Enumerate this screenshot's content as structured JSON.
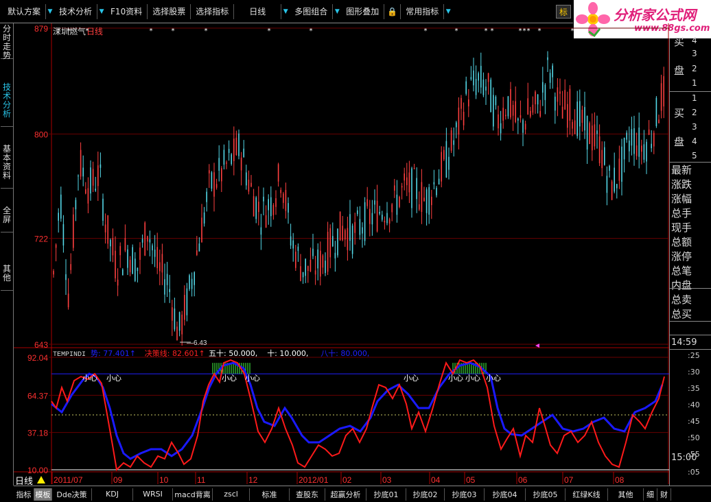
{
  "toolbar": {
    "items": [
      {
        "label": "默认方案",
        "arrow": true
      },
      {
        "label": "技术分析",
        "arrow": true
      },
      {
        "label": "F10资料",
        "arrow": false
      },
      {
        "label": "选择股票",
        "arrow": false
      },
      {
        "label": "选择指标",
        "arrow": false
      },
      {
        "label": "日线",
        "arrow": true
      },
      {
        "label": "多图组合",
        "arrow": true
      },
      {
        "label": "图形叠加",
        "arrow": false
      },
      {
        "label": "常用指标",
        "arrow": true
      }
    ],
    "flag_label": "标"
  },
  "brand": {
    "name": "分析家公式网",
    "url": "www.88gs.com"
  },
  "left_tabs": [
    "分时走势",
    "技术分析",
    "基本资料",
    "全屏",
    "其他"
  ],
  "chart": {
    "stock_label": "深圳燃气",
    "period_label": "日线",
    "price_axis": [
      "879",
      "800",
      "722",
      "643"
    ],
    "low_marker": "6.43",
    "indicator_name": "TEMPINDI",
    "indicator_legend": [
      {
        "label": "势: 77.401",
        "arrow": "↑",
        "color": "#2020ff"
      },
      {
        "label": "决策线: 82.601",
        "arrow": "↑",
        "color": "#ff2020"
      },
      {
        "label": "五十: 50.000,",
        "color": "#ffffff"
      },
      {
        "label": "十: 10.000,",
        "color": "#ffffff"
      },
      {
        "label": "八十: 80.000,",
        "color": "#2020ff"
      }
    ],
    "indicator_axis": [
      "92.04",
      "64.37",
      "37.18",
      "10.00"
    ],
    "signal_text": "小心",
    "date_labels": [
      "2011/07",
      "09",
      "10",
      "11",
      "12",
      "2012/01",
      "02",
      "03",
      "04",
      "05",
      "06",
      "07",
      "08"
    ]
  },
  "right_panel": {
    "buy_char_1": "买",
    "buy_char_2": "盘",
    "levels_top": [
      "4",
      "3",
      "2",
      "1"
    ],
    "levels_bottom": [
      "1",
      "2",
      "3",
      "4",
      "5"
    ],
    "labels": [
      "最新",
      "涨跌",
      "涨幅",
      "总手",
      "现手",
      "总额",
      "涨停",
      "总笔",
      "内盘",
      "总卖",
      "总买"
    ],
    "time_1": "14:59",
    "time_2": "15:00",
    "ticks_1": [
      ":25",
      ":30",
      ":35",
      ":40",
      ":45",
      ":50",
      ":55"
    ],
    "ticks_2": [
      ":05"
    ]
  },
  "bottom_tabs": [
    "指标",
    "模板",
    "Dde决策",
    "KDJ",
    "WRSI",
    "macd背离",
    "zscl",
    "标准",
    "查股东",
    "超赢分析",
    "抄底01",
    "抄底02",
    "抄底03",
    "抄底04",
    "抄底05",
    "红绿K线",
    "其他",
    "细",
    "财"
  ],
  "colors": {
    "up": "#ff4040",
    "down": "#54d8e8",
    "indicator_blue": "#2020ff",
    "indicator_red": "#ff2020",
    "accent": "#29c4e8"
  }
}
